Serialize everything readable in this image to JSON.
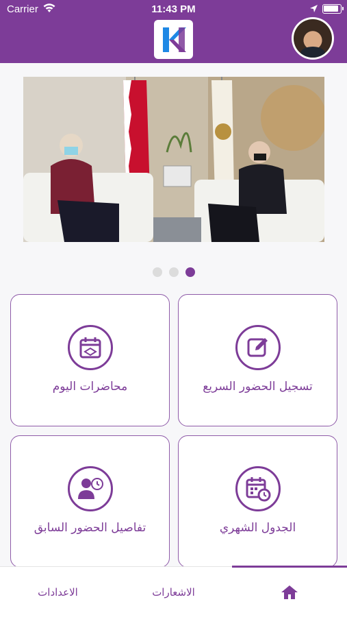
{
  "status_bar": {
    "carrier": "Carrier",
    "time": "11:43 PM"
  },
  "header": {
    "logo_icon": "app-logo-k",
    "avatar_icon": "user-avatar"
  },
  "carousel": {
    "page_count": 3,
    "active_index": 2
  },
  "tiles": [
    {
      "id": "quick-attendance",
      "label": "تسجيل الحضور السريع",
      "icon": "edit-icon"
    },
    {
      "id": "today-lectures",
      "label": "محاضرات اليوم",
      "icon": "calendar-board-icon"
    },
    {
      "id": "monthly-schedule",
      "label": "الجدول الشهري",
      "icon": "calendar-clock-icon"
    },
    {
      "id": "previous-attendance",
      "label": "تفاصيل الحضور السابق",
      "icon": "user-clock-icon"
    }
  ],
  "tabbar": {
    "home_icon": "home-icon",
    "notifications": "الاشعارات",
    "settings": "الاعدادات"
  },
  "colors": {
    "primary": "#7d3c98",
    "background": "#f7f7f9"
  }
}
